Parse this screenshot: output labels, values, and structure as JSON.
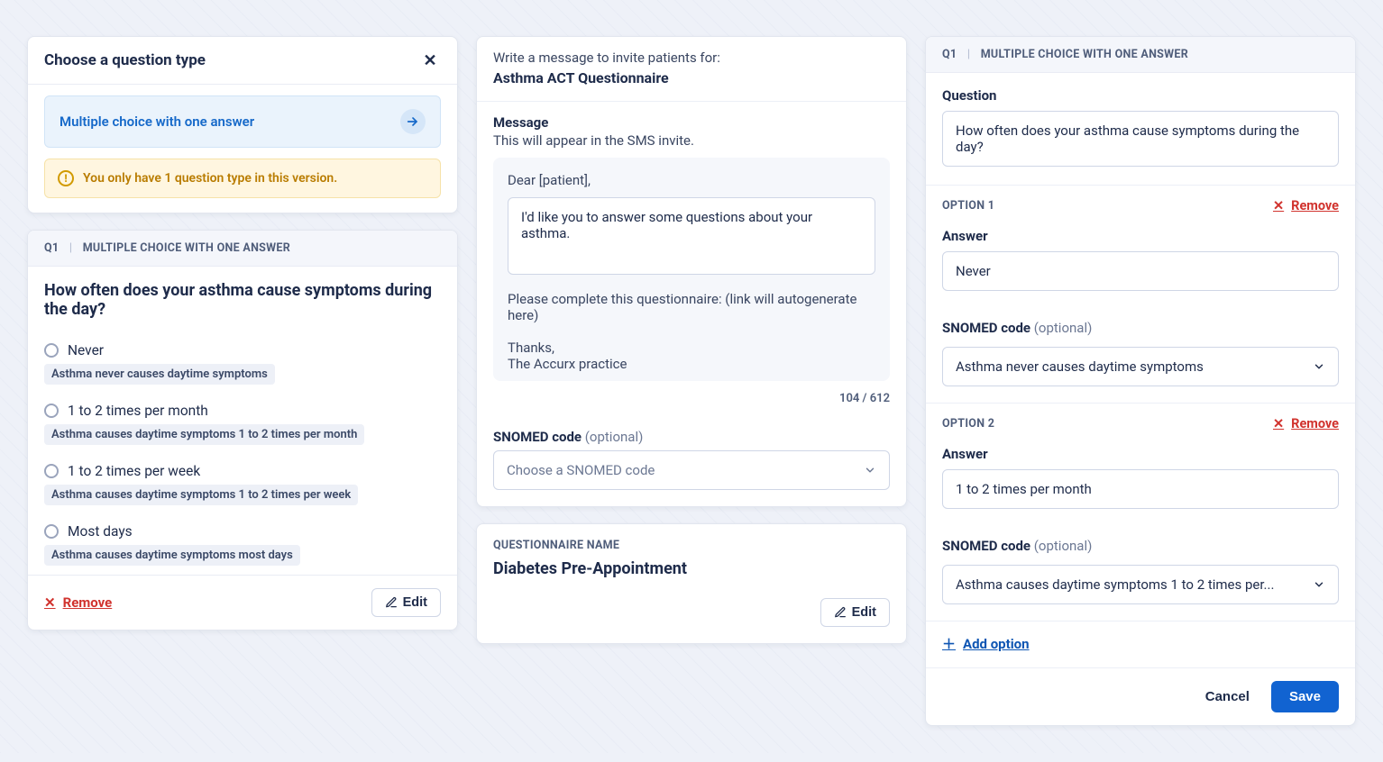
{
  "left": {
    "choose_title": "Choose a question type",
    "type_option": "Multiple choice with one answer",
    "warning": "You only have 1 question type in this version.",
    "q_num": "Q1",
    "q_type": "MULTIPLE CHOICE WITH ONE ANSWER",
    "question": "How often does your asthma cause symptoms during the day?",
    "options": [
      {
        "label": "Never",
        "tag": "Asthma never causes daytime symptoms"
      },
      {
        "label": "1 to 2 times per month",
        "tag": "Asthma causes daytime symptoms 1 to 2 times per month"
      },
      {
        "label": "1 to 2 times per week",
        "tag": "Asthma causes daytime symptoms 1 to 2 times per week"
      },
      {
        "label": "Most days",
        "tag": "Asthma causes daytime symptoms most days"
      }
    ],
    "remove": "Remove",
    "edit": "Edit"
  },
  "middle": {
    "lead": "Write a message to invite patients for:",
    "title": "Asthma ACT Questionnaire",
    "message_label": "Message",
    "message_sub": "This will appear in the SMS invite.",
    "greeting": "Dear [patient],",
    "body": "I'd like you to answer some questions about your asthma.",
    "follow1": "Please complete this questionnaire: (link will autogenerate here)",
    "follow2": "Thanks,",
    "follow3": "The Accurx practice",
    "counter": "104 / 612",
    "snomed_label": "SNOMED code",
    "optional": "(optional)",
    "snomed_placeholder": "Choose a SNOMED code",
    "qn_section": "QUESTIONNAIRE NAME",
    "qn_name": "Diabetes Pre-Appointment",
    "edit": "Edit"
  },
  "right": {
    "q_num": "Q1",
    "q_type": "MULTIPLE CHOICE WITH ONE ANSWER",
    "question_label": "Question",
    "question_value": "How often does your asthma cause symptoms during the day?",
    "answer_label": "Answer",
    "snomed_label": "SNOMED code",
    "optional": "(optional)",
    "option1_title": "OPTION 1",
    "option1_answer": "Never",
    "option1_snomed": "Asthma never causes daytime symptoms",
    "option2_title": "OPTION 2",
    "option2_answer": "1 to 2 times per month",
    "option2_snomed": "Asthma causes daytime symptoms 1 to 2 times per...",
    "remove": "Remove",
    "add_option": "Add option",
    "cancel": "Cancel",
    "save": "Save"
  }
}
